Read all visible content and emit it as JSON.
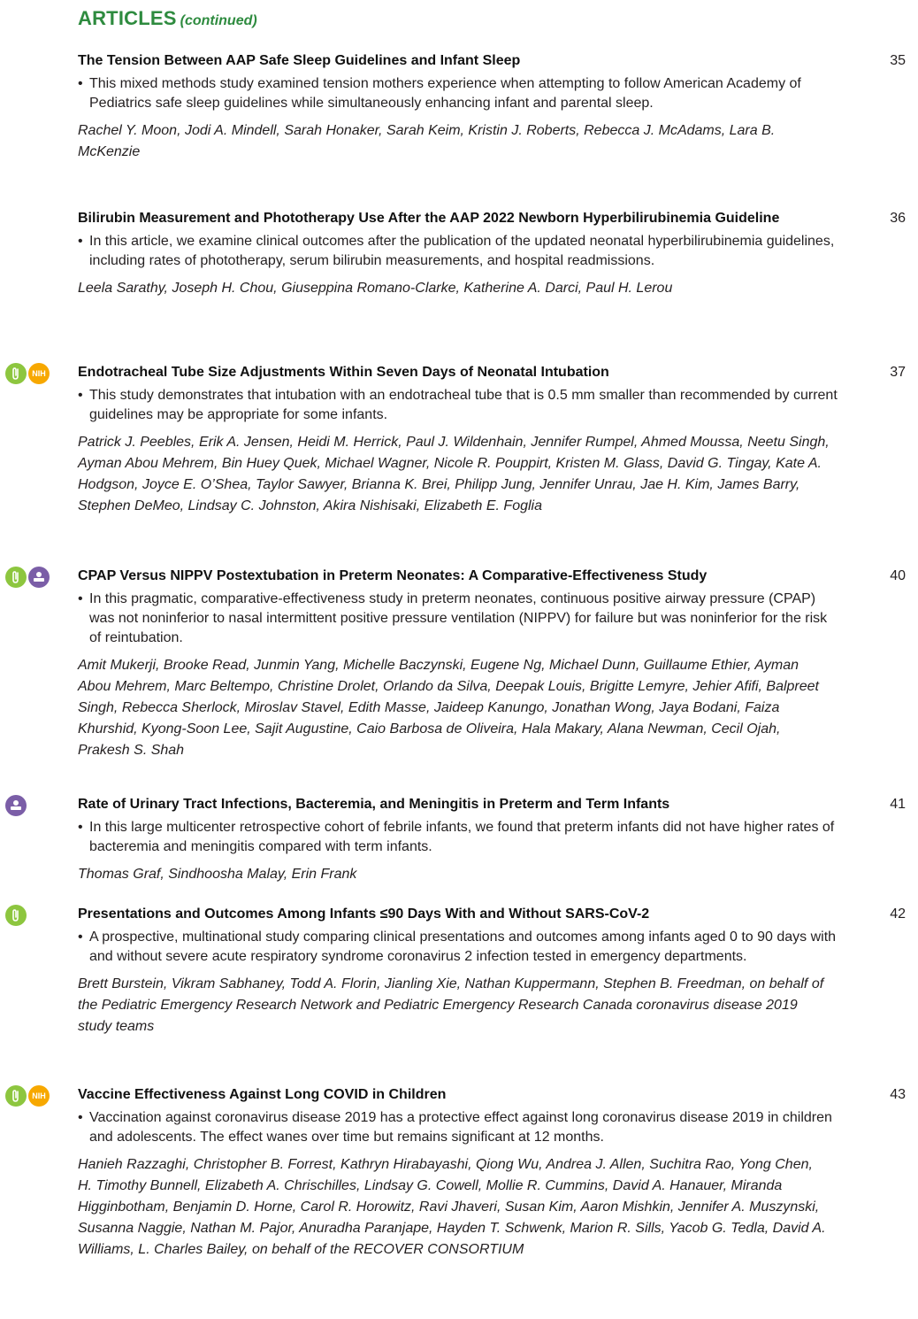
{
  "header": {
    "main": "ARTICLES",
    "continued": "(continued)"
  },
  "articles": [
    {
      "title": "The Tension Between AAP Safe Sleep Guidelines and Infant Sleep",
      "page": "35",
      "summary": "This mixed methods study examined tension mothers experience when attempting to follow American Academy of Pediatrics safe sleep guidelines while simultaneously enhancing infant and parental sleep.",
      "authors": "Rachel Y. Moon, Jodi A. Mindell, Sarah Honaker, Sarah Keim, Kristin J. Roberts, Rebecca J. McAdams, Lara B. McKenzie",
      "icons": []
    },
    {
      "title": "Bilirubin Measurement and Phototherapy Use After the AAP 2022 Newborn Hyperbilirubinemia Guideline",
      "page": "36",
      "summary": "In this article, we examine clinical outcomes after the publication of the updated neonatal hyperbilirubinemia guidelines, including rates of phototherapy, serum bilirubin measurements, and hospital readmissions.",
      "authors": "Leela Sarathy, Joseph H. Chou, Giuseppina Romano-Clarke, Katherine A. Darci, Paul H. Lerou",
      "icons": []
    },
    {
      "title": "Endotracheal Tube Size Adjustments Within Seven Days of Neonatal Intubation",
      "page": "37",
      "summary": "This study demonstrates that intubation with an endotracheal tube that is 0.5 mm smaller than recommended by current guidelines may be appropriate for some infants.",
      "authors": "Patrick J. Peebles, Erik A. Jensen, Heidi M. Herrick, Paul J. Wildenhain, Jennifer Rumpel, Ahmed Moussa, Neetu Singh, Ayman Abou Mehrem, Bin Huey Quek, Michael Wagner, Nicole R. Pouppirt, Kristen M. Glass, David G. Tingay, Kate A. Hodgson, Joyce E. O’Shea, Taylor Sawyer, Brianna K. Brei, Philipp Jung, Jennifer Unrau, Jae H. Kim, James Barry, Stephen DeMeo, Lindsay C. Johnston, Akira Nishisaki, Elizabeth E. Foglia",
      "icons": [
        "clip",
        "nih"
      ]
    },
    {
      "title": "CPAP Versus NIPPV Postextubation in Preterm Neonates: A Comparative-Effectiveness Study",
      "page": "40",
      "summary": "In this pragmatic, comparative-effectiveness study in preterm neonates, continuous positive airway pressure (CPAP) was not noninferior to nasal intermittent positive pressure ventilation (NIPPV) for failure but was noninferior for the risk of reintubation.",
      "authors": "Amit Mukerji, Brooke Read, Junmin Yang, Michelle Baczynski, Eugene Ng, Michael Dunn, Guillaume Ethier, Ayman Abou Mehrem, Marc Beltempo, Christine Drolet, Orlando da Silva, Deepak Louis, Brigitte Lemyre, Jehier Afifi, Balpreet Singh, Rebecca Sherlock, Miroslav Stavel, Edith Masse, Jaideep Kanungo, Jonathan Wong, Jaya Bodani, Faiza Khurshid, Kyong-Soon Lee, Sajit Augustine, Caio Barbosa de Oliveira, Hala Makary, Alana Newman, Cecil Ojah, Prakesh S. Shah",
      "icons": [
        "clip",
        "patient"
      ]
    },
    {
      "title": "Rate of Urinary Tract Infections, Bacteremia, and Meningitis in Preterm and Term Infants",
      "page": "41",
      "summary": "In this large multicenter retrospective cohort of febrile infants, we found that preterm infants did not have higher rates of bacteremia and meningitis compared with term infants.",
      "authors": "Thomas Graf, Sindhoosha Malay, Erin Frank",
      "icons": [
        "patient"
      ]
    },
    {
      "title": "Presentations and Outcomes Among Infants ≤90 Days With and Without SARS-CoV-2",
      "page": "42",
      "summary": "A prospective, multinational study comparing clinical presentations and outcomes among infants aged 0 to 90 days with and without severe acute respiratory syndrome coronavirus 2 infection tested in emergency departments.",
      "authors": "Brett Burstein, Vikram Sabhaney, Todd A. Florin, Jianling Xie, Nathan Kuppermann, Stephen B. Freedman, on behalf of the Pediatric Emergency Research Network and Pediatric Emergency Research Canada coronavirus disease 2019 study teams",
      "icons": [
        "clip"
      ]
    },
    {
      "title": "Vaccine Effectiveness Against Long COVID in Children",
      "page": "43",
      "summary": "Vaccination against coronavirus disease 2019 has a protective effect against long coronavirus disease 2019 in children and adolescents. The effect wanes over time but remains significant at 12 months.",
      "authors": "Hanieh Razzaghi, Christopher B. Forrest, Kathryn Hirabayashi, Qiong Wu, Andrea J. Allen, Suchitra Rao, Yong Chen, H. Timothy Bunnell, Elizabeth A. Chrischilles, Lindsay G. Cowell, Mollie R. Cummins, David A. Hanauer, Miranda Higginbotham, Benjamin D. Horne, Carol R. Horowitz, Ravi Jhaveri, Susan Kim, Aaron Mishkin, Jennifer A. Muszynski, Susanna Naggie, Nathan M. Pajor, Anuradha Paranjape, Hayden T. Schwenk, Marion R. Sills, Yacob G. Tedla, David A. Williams, L. Charles Bailey, on behalf of the RECOVER CONSORTIUM",
      "icons": [
        "clip",
        "nih"
      ]
    }
  ]
}
